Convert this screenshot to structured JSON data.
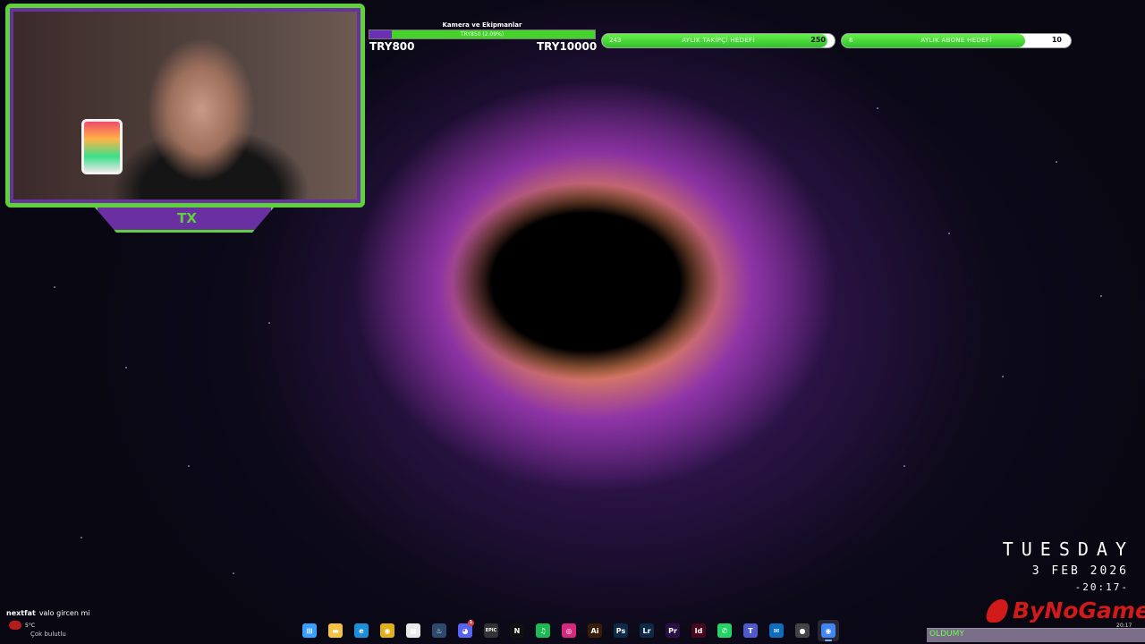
{
  "overlay": {
    "equipment_goal": {
      "title": "Kamera ve Ekipmanlar",
      "progress_text": "TRY850 (2.09%)",
      "progress_fraction": 0.1,
      "min_label": "TRY800",
      "max_label": "TRY10000",
      "fill_color": "#6b2fb5",
      "rest_color": "#45d22b"
    },
    "follower_goal": {
      "current": "243",
      "label": "AYLIK TAKİPÇİ HEDEFİ",
      "max": "250",
      "progress_fraction": 0.97
    },
    "subscriber_goal": {
      "current": "8",
      "label": "AYLIK ABONE HEDEFİ",
      "max": "10",
      "progress_fraction": 0.8
    },
    "accent_color": "#5fd13a",
    "frame_color": "#6a2fa0"
  },
  "clock_widget": {
    "day": "TUESDAY",
    "date": "3 FEB 2026",
    "time": "-20:17-"
  },
  "brand": {
    "name": "ByNoGame"
  },
  "chat": {
    "username": "nextfat",
    "message": "valo gircen mi"
  },
  "weather": {
    "temperature": "5°C",
    "condition": "Çok bulutlu"
  },
  "taskbar": {
    "icons": [
      {
        "name": "windows-start-icon",
        "glyph": "⊞",
        "color": "#3aa0ff"
      },
      {
        "name": "file-explorer-icon",
        "glyph": "▬",
        "color": "#f5c242"
      },
      {
        "name": "edge-browser-icon",
        "glyph": "e",
        "color": "#1e8fdb"
      },
      {
        "name": "chrome-browser-icon",
        "glyph": "◉",
        "color": "#e0b11a"
      },
      {
        "name": "microsoft-store-icon",
        "glyph": "▦",
        "color": "#e9e9e9"
      },
      {
        "name": "steam-icon",
        "glyph": "♨",
        "color": "#2c4a6e"
      },
      {
        "name": "discord-icon",
        "glyph": "◕",
        "color": "#5865f2"
      },
      {
        "name": "epic-games-icon",
        "glyph": "EPIC",
        "color": "#333333"
      },
      {
        "name": "netflix-icon",
        "glyph": "N",
        "color": "#101010"
      },
      {
        "name": "spotify-icon",
        "glyph": "♫",
        "color": "#1db954"
      },
      {
        "name": "instagram-icon",
        "glyph": "◎",
        "color": "#d6287c"
      },
      {
        "name": "illustrator-icon",
        "glyph": "Ai",
        "color": "#3a1d08"
      },
      {
        "name": "photoshop-icon",
        "glyph": "Ps",
        "color": "#0d2a47"
      },
      {
        "name": "lightroom-icon",
        "glyph": "Lr",
        "color": "#0d2a47"
      },
      {
        "name": "premiere-icon",
        "glyph": "Pr",
        "color": "#2a0f44"
      },
      {
        "name": "indesign-icon",
        "glyph": "Id",
        "color": "#49071f"
      },
      {
        "name": "whatsapp-icon",
        "glyph": "✆",
        "color": "#25d366"
      },
      {
        "name": "teams-icon",
        "glyph": "T",
        "color": "#5059c9"
      },
      {
        "name": "outlook-icon",
        "glyph": "✉",
        "color": "#0f6cbd"
      },
      {
        "name": "obs-icon",
        "glyph": "●",
        "color": "#444444"
      },
      {
        "name": "chrome-active-icon",
        "glyph": "◉",
        "color": "#4285f4"
      }
    ],
    "discord_badge": "1"
  },
  "tray": {
    "label": "OLDUMY",
    "time": "20:17"
  }
}
